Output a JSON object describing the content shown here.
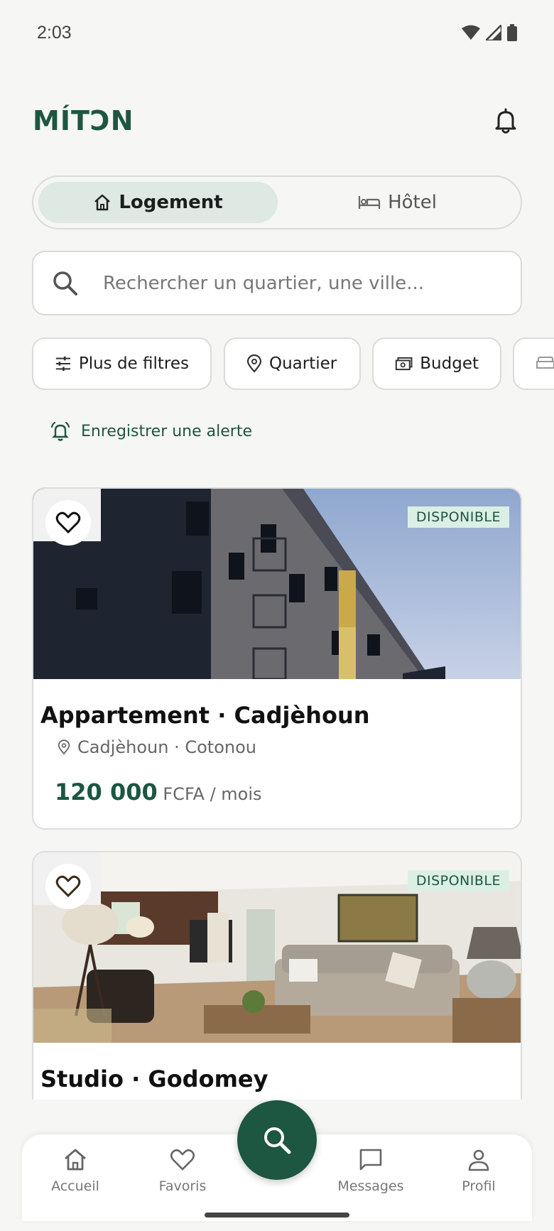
{
  "status_bar": {
    "time": "2:03"
  },
  "header": {
    "logo": "MÍTƆN"
  },
  "segments": {
    "housing": "Logement",
    "hotel": "Hôtel"
  },
  "search": {
    "placeholder": "Rechercher un quartier, une ville..."
  },
  "filters": {
    "more_filters": "Plus de filtres",
    "neighborhood": "Quartier",
    "budget": "Budget"
  },
  "alert": {
    "label": "Enregistrer une alerte"
  },
  "listings": [
    {
      "badge": "DISPONIBLE",
      "title": "Appartement · Cadjèhoun",
      "location": "Cadjèhoun · Cotonou",
      "price": "120 000",
      "price_unit": "FCFA / mois"
    },
    {
      "badge": "DISPONIBLE",
      "title": "Studio · Godomey"
    }
  ],
  "bottom_nav": {
    "home": "Accueil",
    "favorites": "Favoris",
    "messages": "Messages",
    "profile": "Profil"
  },
  "colors": {
    "brand": "#1d5641",
    "accent_light": "#dde9e2",
    "background": "#f6f6f4"
  }
}
